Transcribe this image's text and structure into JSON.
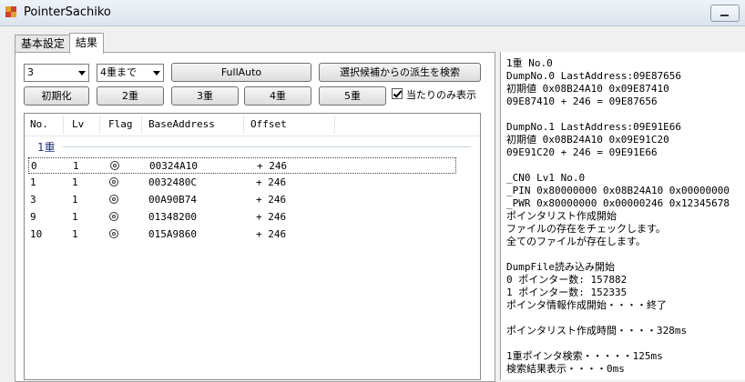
{
  "window": {
    "title": "PointerSachiko"
  },
  "tabs": [
    {
      "label": "基本設定"
    },
    {
      "label": "結果"
    }
  ],
  "toolbar": {
    "level_combo": "3",
    "depth_combo": "4重まで",
    "fullauto_label": "FullAuto",
    "search_derived_label": "選択候補からの派生を検索",
    "init_label": "初期化",
    "level2_label": "2重",
    "level3_label": "3重",
    "level4_label": "4重",
    "level5_label": "5重",
    "hits_only_label": "当たりのみ表示",
    "hits_only_checked": true
  },
  "results": {
    "columns": [
      "No.",
      "Lv",
      "Flag",
      "BaseAddress",
      "Offset"
    ],
    "group_label": "1重",
    "rows": [
      {
        "no": "0",
        "lv": "1",
        "base": "00324A10",
        "offset": "+ 246"
      },
      {
        "no": "1",
        "lv": "1",
        "base": "0032480C",
        "offset": "+ 246"
      },
      {
        "no": "3",
        "lv": "1",
        "base": "00A90B74",
        "offset": "+ 246"
      },
      {
        "no": "9",
        "lv": "1",
        "base": "01348200",
        "offset": "+ 246"
      },
      {
        "no": "10",
        "lv": "1",
        "base": "015A9860",
        "offset": "+ 246"
      }
    ]
  },
  "log": [
    "1重    No.0",
    "DumpNo.0    LastAddress:09E87656",
    "初期値 0x08B24A10 0x09E87410",
    "09E87410 + 246 = 09E87656",
    "",
    "DumpNo.1    LastAddress:09E91E66",
    "初期値 0x08B24A10 0x09E91C20",
    "09E91C20 + 246 = 09E91E66",
    "",
    "_CN0 Lv1 No.0",
    "_PIN 0x80000000 0x08B24A10 0x00000000",
    "_PWR 0x80000000 0x00000246 0x12345678",
    "ポインタリスト作成開始",
    "ファイルの存在をチェックします。",
    "全てのファイルが存在します。",
    "",
    "DumpFile読み込み開始",
    "0  ポインター数:   157882",
    "1  ポインター数:   152335",
    "ポインタ情報作成開始・・・・終了",
    "",
    "ポインタリスト作成時間・・・・328ms",
    "",
    "1重ポインタ検索・・・・・125ms",
    "検索結果表示・・・・0ms"
  ]
}
